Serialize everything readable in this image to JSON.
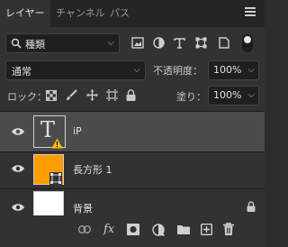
{
  "tabs": [
    {
      "label": "レイヤー",
      "active": true
    },
    {
      "label": "チャンネル",
      "active": false
    },
    {
      "label": "パス",
      "active": false
    }
  ],
  "filter": {
    "kind_label": "種類"
  },
  "blend": {
    "mode": "通常",
    "opacity_label": "不透明度：",
    "opacity_value": "100%",
    "fill_label": "塗り：",
    "fill_value": "100%"
  },
  "lock": {
    "label": "ロック："
  },
  "layers": [
    {
      "name": "iP",
      "type": "text",
      "selected": true,
      "warning": true
    },
    {
      "name": "長方形 1",
      "type": "shape",
      "selected": false
    },
    {
      "name": "背景",
      "type": "background",
      "selected": false,
      "locked": true
    }
  ],
  "colors": {
    "shape_fill": "#ff9c00",
    "warning": "#ffc000",
    "background_thumb": "#ffffff"
  }
}
